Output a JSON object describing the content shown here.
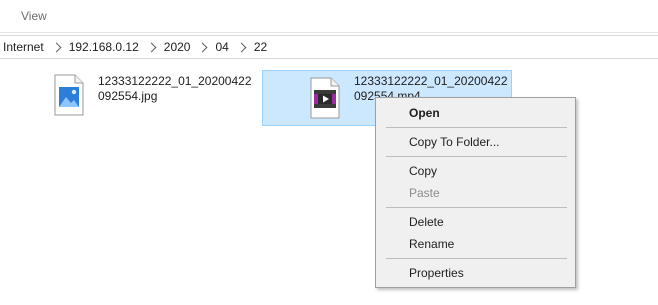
{
  "ribbon": {
    "view_tab": "View"
  },
  "address": {
    "crumbs": [
      "Internet",
      "192.168.0.12",
      "2020",
      "04",
      "22"
    ]
  },
  "files": [
    {
      "name": "12333122222_01_20200422092554.jpg",
      "type": "image",
      "selected": false
    },
    {
      "name": "12333122222_01_20200422092554.mp4",
      "type": "video",
      "selected": true
    }
  ],
  "context_menu": {
    "open": "Open",
    "copy_to_folder": "Copy To Folder...",
    "copy": "Copy",
    "paste": "Paste",
    "delete": "Delete",
    "rename": "Rename",
    "properties": "Properties"
  },
  "colors": {
    "selection_bg": "#cce8ff",
    "selection_border": "#99d1ff",
    "menu_bg": "#f0f0f0",
    "image_icon": "#2b7fd9",
    "video_icon": "#9c2aa0"
  }
}
